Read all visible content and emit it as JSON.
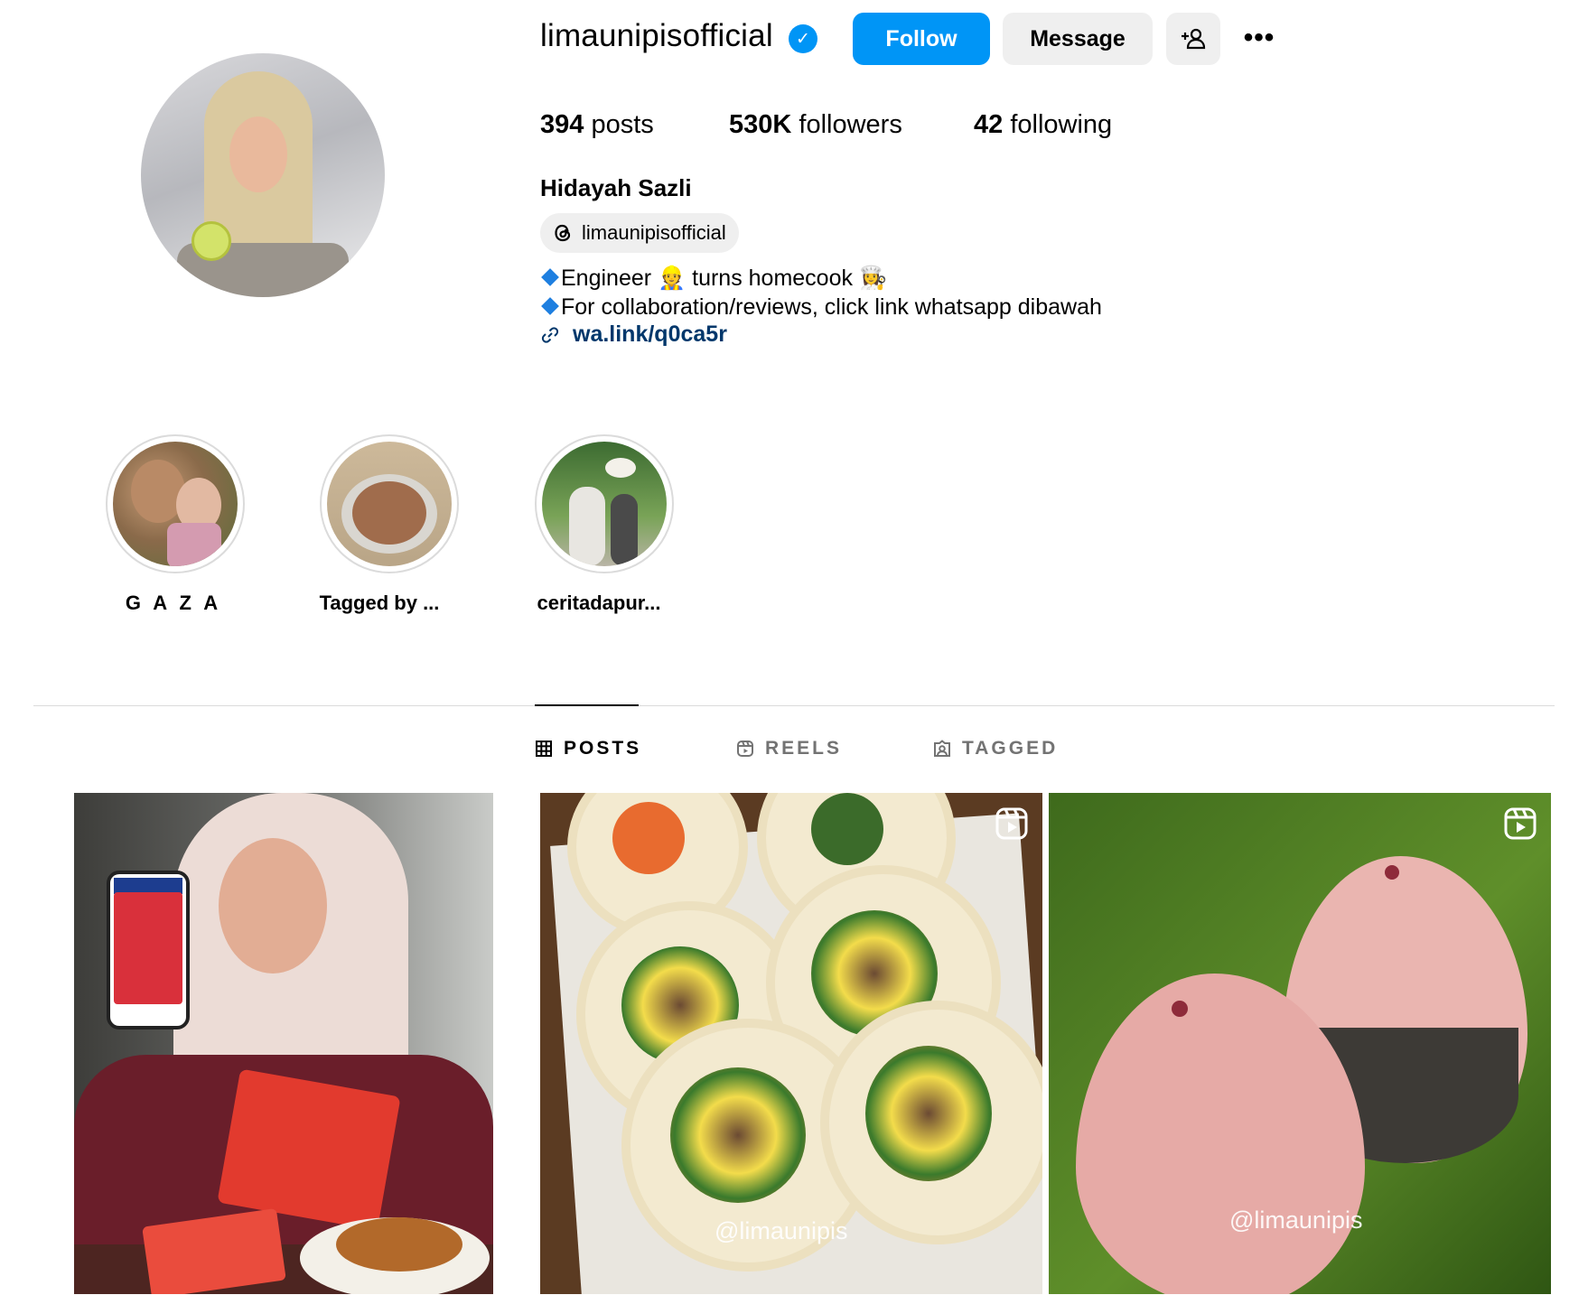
{
  "profile": {
    "username": "limaunipisofficial",
    "verified": true,
    "follow_label": "Follow",
    "message_label": "Message",
    "stats": {
      "posts_count": "394",
      "posts_label": "posts",
      "followers_count": "530K",
      "followers_label": "followers",
      "following_count": "42",
      "following_label": "following"
    },
    "full_name": "Hidayah Sazli",
    "threads_handle": "limaunipisofficial",
    "bio_line1_a": "Engineer ",
    "bio_line1_b": " turns homecook ",
    "emoji_engineer": "👷",
    "emoji_cook": "👩‍🍳",
    "bio_line2": "For collaboration/reviews, click link whatsapp dibawah",
    "link": "wa.link/q0ca5r"
  },
  "highlights": [
    {
      "label": "G A Z A"
    },
    {
      "label": "Tagged by ..."
    },
    {
      "label": "ceritadapur..."
    }
  ],
  "tabs": [
    {
      "label": "POSTS",
      "active": true
    },
    {
      "label": "REELS",
      "active": false
    },
    {
      "label": "TAGGED",
      "active": false
    }
  ],
  "posts": [
    {
      "type": "photo",
      "watermark": ""
    },
    {
      "type": "reel",
      "watermark": "@limaunipis"
    },
    {
      "type": "reel",
      "watermark": "@limaunipis"
    }
  ],
  "colors": {
    "primary_button": "#0095f6",
    "secondary_button": "#efefef",
    "link": "#00376b",
    "divider": "#dbdbdb"
  }
}
